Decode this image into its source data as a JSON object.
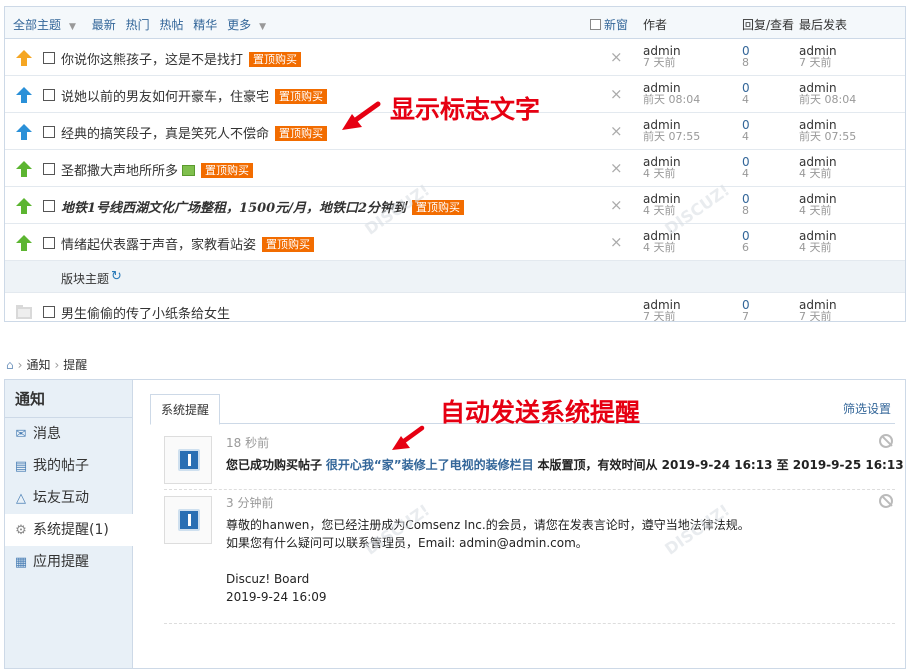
{
  "forum": {
    "tabs": [
      "全部主题",
      "最新",
      "热门",
      "热帖",
      "精华",
      "更多"
    ],
    "new_window": "新窗",
    "col_author": "作者",
    "col_replies": "回复/查看",
    "col_last": "最后发表",
    "tag_label": "置顶购买",
    "threads": [
      {
        "title": "你说你这熊孩子，这是不是找打",
        "author": "admin",
        "author_time": "7 天前",
        "replies": "0",
        "views": "8",
        "last_user": "admin",
        "last_time": "7 天前",
        "icon_color": "#f5a623",
        "bold": false,
        "has_tag": true
      },
      {
        "title": "说她以前的男友如何开豪车，住豪宅",
        "author": "admin",
        "author_time": "前天 08:04",
        "replies": "0",
        "views": "4",
        "last_user": "admin",
        "last_time": "前天 08:04",
        "icon_color": "#2a90d8",
        "bold": false,
        "has_tag": true
      },
      {
        "title": "经典的搞笑段子，真是笑死人不偿命",
        "author": "admin",
        "author_time": "前天 07:55",
        "replies": "0",
        "views": "4",
        "last_user": "admin",
        "last_time": "前天 07:55",
        "icon_color": "#2a90d8",
        "bold": false,
        "has_tag": true
      },
      {
        "title": "圣都撒大声地所所多",
        "author": "admin",
        "author_time": "4 天前",
        "replies": "0",
        "views": "4",
        "last_user": "admin",
        "last_time": "4 天前",
        "icon_color": "#5cb531",
        "bold": false,
        "has_tag": true
      },
      {
        "title": "地铁1号线西湖文化广场整租，1500元/月，地铁口2分钟到",
        "author": "admin",
        "author_time": "4 天前",
        "replies": "0",
        "views": "8",
        "last_user": "admin",
        "last_time": "4 天前",
        "icon_color": "#5cb531",
        "bold": true,
        "has_tag": true
      },
      {
        "title": "情绪起伏表露于声音，家教看站姿",
        "author": "admin",
        "author_time": "4 天前",
        "replies": "0",
        "views": "6",
        "last_user": "admin",
        "last_time": "4 天前",
        "icon_color": "#5cb531",
        "bold": false,
        "has_tag": true
      }
    ],
    "section_label": "版块主题",
    "normal_thread": {
      "title": "男生偷偷的传了小纸条给女生",
      "author": "admin",
      "author_time": "7 天前",
      "replies": "0",
      "views": "7",
      "last_user": "admin",
      "last_time": "7 天前"
    }
  },
  "annotations": {
    "top": "显示标志文字",
    "bottom": "自动发送系统提醒"
  },
  "breadcrumb": {
    "home": "home-icon",
    "level1": "通知",
    "level2": "提醒"
  },
  "sidebar": {
    "title": "通知",
    "items": [
      {
        "label": "消息",
        "icon": "mail-icon"
      },
      {
        "label": "我的帖子",
        "icon": "document-icon"
      },
      {
        "label": "坛友互动",
        "icon": "triangle-icon"
      },
      {
        "label": "系统提醒(1)",
        "icon": "gear-icon"
      },
      {
        "label": "应用提醒",
        "icon": "grid-icon"
      }
    ]
  },
  "notice": {
    "tab_label": "系统提醒",
    "filter_label": "筛选设置",
    "items": [
      {
        "time": "18 秒前",
        "prefix": "您已成功购买帖子",
        "link": "很开心我“家”装修上了电视的装修栏目",
        "suffix": "本版置顶，有效时间从 2019-9-24 16:13 至 2019-9-25 16:13"
      },
      {
        "time": "3 分钟前",
        "line1": "尊敬的hanwen，您已经注册成为Comsenz Inc.的会员，请您在发表言论时，遵守当地法律法规。",
        "line2": "如果您有什么疑问可以联系管理员，Email: admin@admin.com。",
        "line3": "Discuz! Board",
        "line4": "2019-9-24 16:09"
      }
    ]
  },
  "colors": {
    "accent_red": "#e60012",
    "tag_orange": "#f26c00",
    "link_blue": "#336699"
  }
}
